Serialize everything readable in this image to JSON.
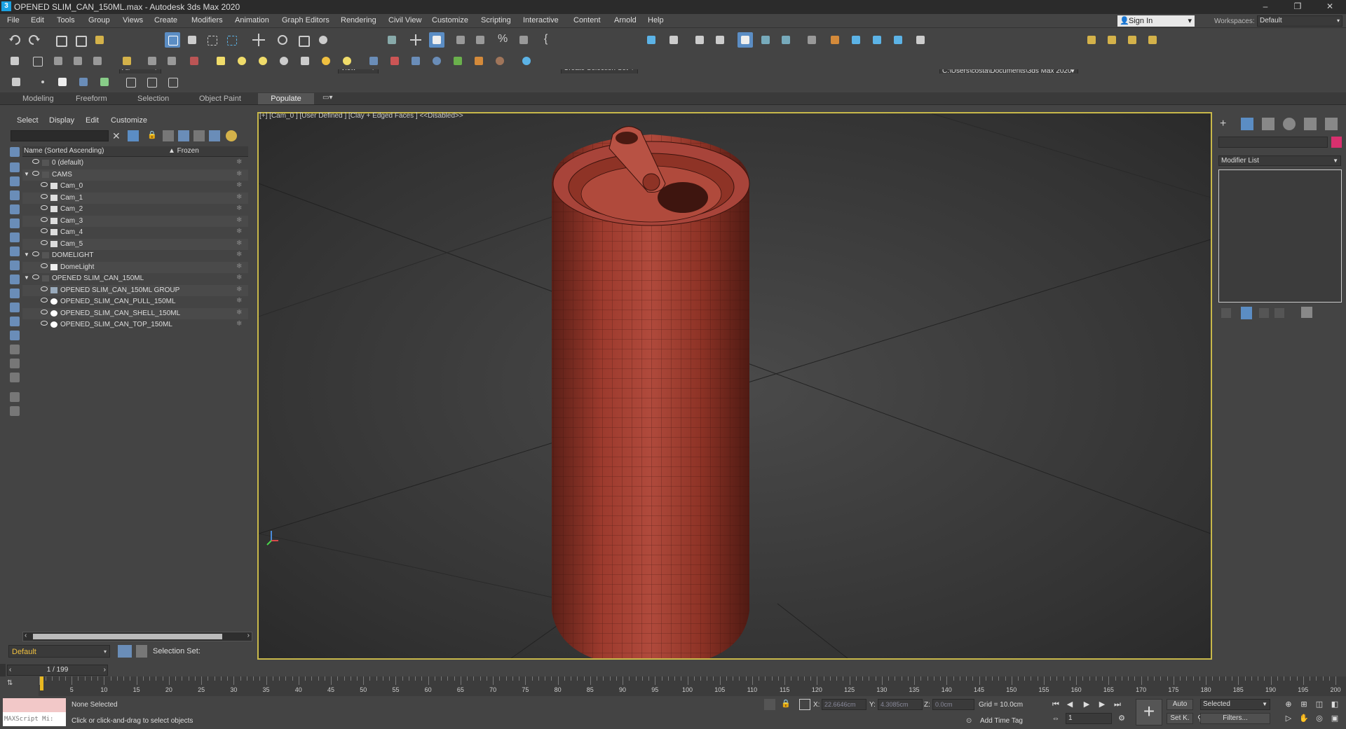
{
  "window": {
    "title": "OPENED SLIM_CAN_150ML.max - Autodesk 3ds Max 2020",
    "logo": "3",
    "minimize": "–",
    "restore": "❐",
    "close": "✕"
  },
  "menu": [
    "File",
    "Edit",
    "Tools",
    "Group",
    "Views",
    "Create",
    "Modifiers",
    "Animation",
    "Graph Editors",
    "Rendering",
    "Civil View",
    "Customize",
    "Scripting",
    "Interactive",
    "Content",
    "Arnold",
    "Help"
  ],
  "account": {
    "sign_in": "Sign In",
    "workspaces_label": "Workspaces:",
    "workspace": "Default"
  },
  "toolbar": {
    "filter": "All",
    "ref_coord": "View",
    "selection_set": "Create Selection Set",
    "project_path": "C:\\Users\\costa\\Documents\\3ds Max 2020"
  },
  "ribbon_tabs": [
    "Modeling",
    "Freeform",
    "Selection",
    "Object Paint"
  ],
  "ribbon_active": "Populate",
  "explorer": {
    "menu": [
      "Select",
      "Display",
      "Edit",
      "Customize"
    ],
    "col_name": "Name (Sorted Ascending)",
    "col_frozen": "▲ Frozen",
    "rows": [
      {
        "label": "0 (default)",
        "indent": 0,
        "icon": "layer-icon",
        "expander": ""
      },
      {
        "label": "CAMS",
        "indent": 0,
        "icon": "layer-icon",
        "expander": "▼"
      },
      {
        "label": "Cam_0",
        "indent": 1,
        "icon": "camera-icon",
        "expander": ""
      },
      {
        "label": "Cam_1",
        "indent": 1,
        "icon": "camera-icon",
        "expander": ""
      },
      {
        "label": "Cam_2",
        "indent": 1,
        "icon": "camera-icon",
        "expander": ""
      },
      {
        "label": "Cam_3",
        "indent": 1,
        "icon": "camera-icon",
        "expander": ""
      },
      {
        "label": "Cam_4",
        "indent": 1,
        "icon": "camera-icon",
        "expander": ""
      },
      {
        "label": "Cam_5",
        "indent": 1,
        "icon": "camera-icon",
        "expander": ""
      },
      {
        "label": "DOMELIGHT",
        "indent": 0,
        "icon": "layer-icon",
        "expander": "▼"
      },
      {
        "label": "DomeLight",
        "indent": 1,
        "icon": "light-icon",
        "expander": ""
      },
      {
        "label": "OPENED SLIM_CAN_150ML",
        "indent": 0,
        "icon": "layer-icon",
        "expander": "▼"
      },
      {
        "label": "OPENED SLIM_CAN_150ML GROUP",
        "indent": 1,
        "icon": "group-icon",
        "expander": ""
      },
      {
        "label": "OPENED_SLIM_CAN_PULL_150ML",
        "indent": 1,
        "icon": "geometry-icon",
        "expander": ""
      },
      {
        "label": "OPENED_SLIM_CAN_SHELL_150ML",
        "indent": 1,
        "icon": "geometry-icon",
        "expander": ""
      },
      {
        "label": "OPENED_SLIM_CAN_TOP_150ML",
        "indent": 1,
        "icon": "geometry-icon",
        "expander": ""
      }
    ],
    "layer": "Default",
    "selection_set_label": "Selection Set:"
  },
  "viewport": {
    "label": "[+] [Cam_0 ] [User Defined ] [Clay + Edged Faces ]  <<Disabled>>",
    "can_color": "#b04a3c",
    "border_color": "#c8b84a"
  },
  "command_panel": {
    "modifier_list": "Modifier List",
    "object_color": "#d8306e"
  },
  "timeline": {
    "slider": "1 / 199",
    "ticks": [
      5,
      10,
      15,
      20,
      25,
      30,
      35,
      40,
      45,
      50,
      55,
      60,
      65,
      70,
      75,
      80,
      85,
      90,
      95,
      100,
      105,
      110,
      115,
      120,
      125,
      130,
      135,
      140,
      145,
      150,
      155,
      160,
      165,
      170,
      175,
      180,
      185,
      190,
      195,
      200
    ]
  },
  "status": {
    "maxscript": "MAXScript Mi:",
    "selection": "None Selected",
    "prompt": "Click or click-and-drag to select objects",
    "x_label": "X:",
    "x": "22.6646cm",
    "y_label": "Y:",
    "y": "4.3085cm",
    "z_label": "Z:",
    "z": "0.0cm",
    "grid": "Grid = 10.0cm",
    "add_time_tag": "Add Time Tag",
    "frame": "1",
    "auto_key": "Auto",
    "set_key": "Set K.",
    "key_mode": "Selected",
    "filters": "Filters..."
  }
}
